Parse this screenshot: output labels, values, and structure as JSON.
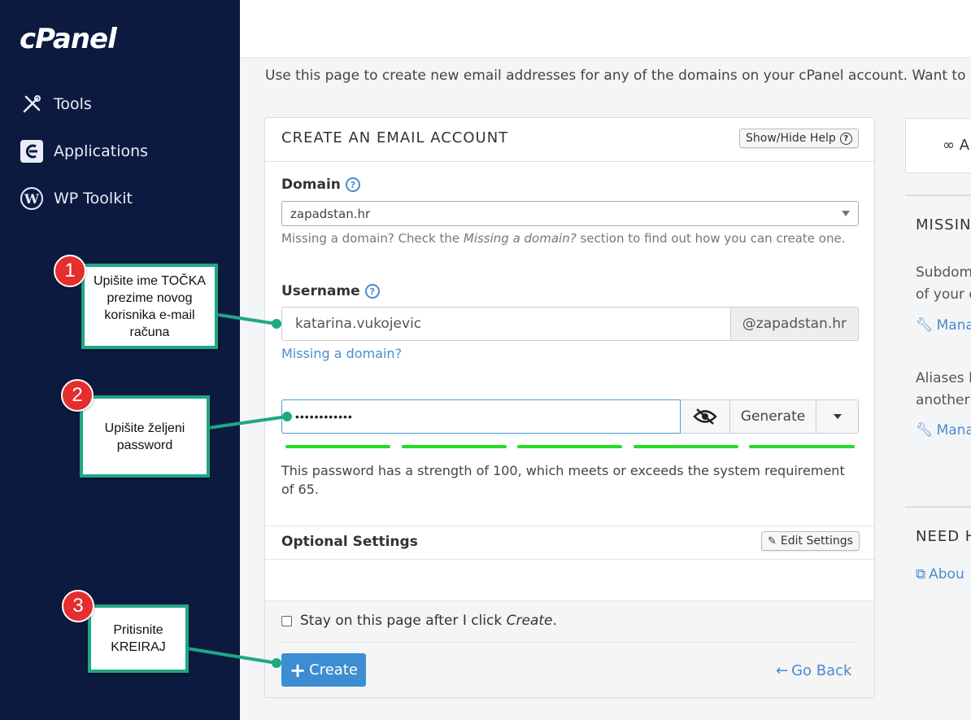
{
  "sidebar": {
    "logo": "cPanel",
    "items": [
      {
        "label": "Tools",
        "icon": "tools-icon"
      },
      {
        "label": "Applications",
        "icon": "applications-icon"
      },
      {
        "label": "WP Toolkit",
        "icon": "wordpress-icon"
      }
    ]
  },
  "intro": "Use this page to create new email addresses for any of the domains on your cPanel account. Want to learn",
  "card": {
    "title": "CREATE AN EMAIL ACCOUNT",
    "help_button": "Show/Hide Help",
    "domain_label": "Domain",
    "domain_value": "zapadstan.hr",
    "domain_help_pre": "Missing a domain? Check the ",
    "domain_help_em": "Missing a domain?",
    "domain_help_post": " section to find out how you can create one.",
    "username_label": "Username",
    "username_value": "katarina.vukojevic",
    "username_suffix": "@zapadstan.hr",
    "missing_link": "Missing a domain?",
    "password_value": "••••••••••••",
    "generate_label": "Generate",
    "strength_text": "This password has a strength of 100, which meets or exceeds the system requirement of 65.",
    "optional_title": "Optional Settings",
    "edit_settings": "Edit Settings",
    "stay_pre": "Stay on this page after I click ",
    "stay_em": "Create",
    "stay_post": ".",
    "create_label": "Create",
    "go_back": "Go Back"
  },
  "right": {
    "box_text": "∞ A",
    "missing_head": "MISSIN",
    "text1a": "Subdom",
    "text1b": "of your d",
    "link1": "Mana",
    "text2a": "Aliases le",
    "text2b": "another",
    "link2": "Mana",
    "need_head": "NEED H",
    "link3": "Abou"
  },
  "annotations": [
    {
      "num": "1",
      "text": "Upišite ime TOČKA prezime novog korisnika e-mail računa"
    },
    {
      "num": "2",
      "text": "Upišite željeni password"
    },
    {
      "num": "3",
      "text": "Pritisnite KREIRAJ"
    }
  ],
  "colors": {
    "sidebar": "#0c1a40",
    "accent": "#3c8dd1",
    "annotation": "#1ea884",
    "badge": "#e52e2e",
    "strength": "#22dd22"
  }
}
